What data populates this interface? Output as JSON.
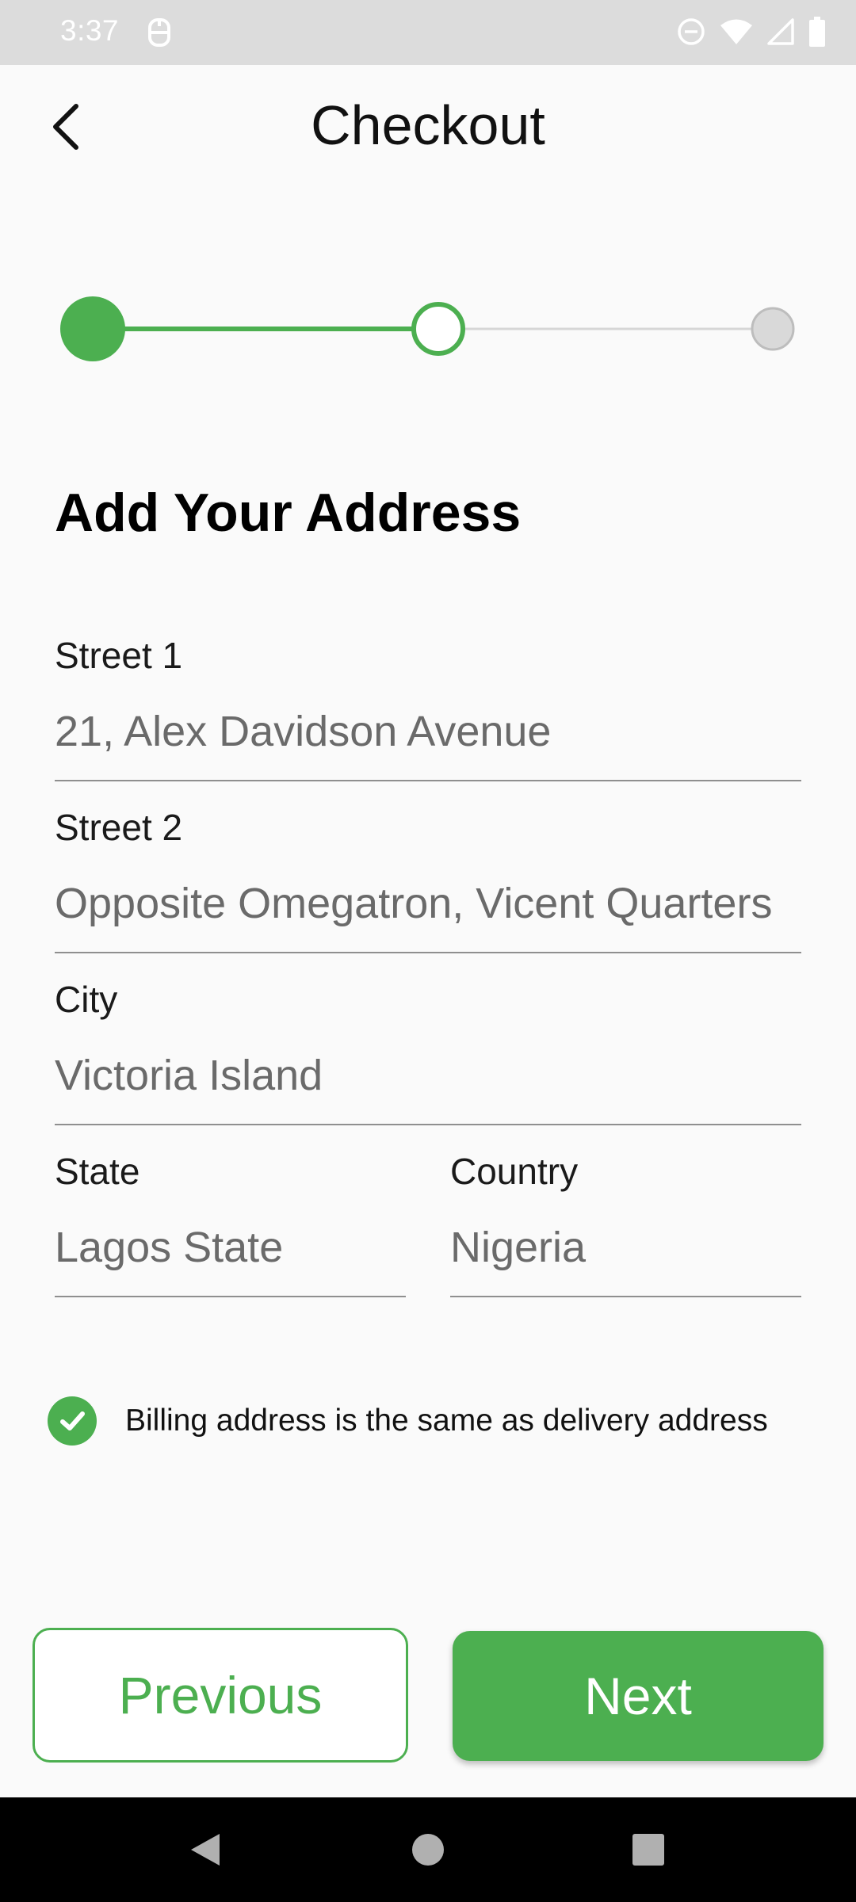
{
  "status_bar": {
    "time": "3:37",
    "icons": [
      "notification-icon",
      "do-not-disturb-icon",
      "wifi-icon",
      "signal-icon",
      "battery-icon"
    ]
  },
  "header": {
    "title": "Checkout",
    "back_icon": "chevron-left-icon"
  },
  "stepper": {
    "steps": 3,
    "current_step": 2,
    "completed_steps": 1,
    "active_color": "#4caf50",
    "inactive_color": "#d9d9d9"
  },
  "form": {
    "title": "Add Your Address",
    "street1": {
      "label": "Street 1",
      "value": "21, Alex Davidson Avenue"
    },
    "street2": {
      "label": "Street 2",
      "value": "Opposite Omegatron, Vicent Quarters"
    },
    "city": {
      "label": "City",
      "value": "Victoria Island"
    },
    "state": {
      "label": "State",
      "value": "Lagos State"
    },
    "country": {
      "label": "Country",
      "value": "Nigeria"
    }
  },
  "billing": {
    "label": "Billing address is the same as delivery address",
    "checked": true
  },
  "buttons": {
    "previous": "Previous",
    "next": "Next"
  },
  "colors": {
    "accent": "#4caf50",
    "background": "#fafafa"
  },
  "nav_bar": {
    "icons": [
      "back-nav-icon",
      "home-nav-icon",
      "recents-nav-icon"
    ]
  }
}
